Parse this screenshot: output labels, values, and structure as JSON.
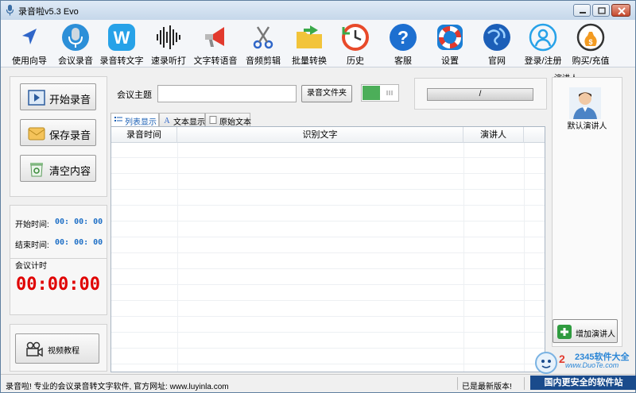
{
  "window": {
    "title": "录音啦v5.3 Evo"
  },
  "toolbar": {
    "items": [
      {
        "label": "使用向导",
        "icon": "navigation-arrow-icon"
      },
      {
        "label": "会议录音",
        "icon": "microphone-icon"
      },
      {
        "label": "录音转文字",
        "icon": "w-letter-icon"
      },
      {
        "label": "速录听打",
        "icon": "waveform-icon"
      },
      {
        "label": "文字转语音",
        "icon": "megaphone-icon"
      },
      {
        "label": "音频剪辑",
        "icon": "scissors-icon"
      },
      {
        "label": "批量转换",
        "icon": "folder-arrow-icon"
      },
      {
        "label": "历史",
        "icon": "history-clock-icon"
      },
      {
        "label": "客服",
        "icon": "question-icon"
      },
      {
        "label": "设置",
        "icon": "lifebuoy-icon"
      },
      {
        "label": "官网",
        "icon": "globe-icon"
      },
      {
        "label": "登录/注册",
        "icon": "user-icon"
      },
      {
        "label": "购买/充值",
        "icon": "money-bag-icon"
      }
    ]
  },
  "left": {
    "start_label": "开始录音",
    "save_label": "保存录音",
    "clear_label": "清空内容",
    "start_time_label": "开始时间:",
    "start_time_value": "00: 00: 00",
    "end_time_label": "结束时间:",
    "end_time_value": "00: 00: 00",
    "timer_caption": "会议计时",
    "timer_value": "00:00:00",
    "video_label": "视频教程"
  },
  "main": {
    "topic_label": "会议主题",
    "topic_value": "",
    "folder_button": "录音文件夹",
    "progress_text": "/",
    "tabs": [
      {
        "label": "列表显示",
        "active": true
      },
      {
        "label": "文本显示",
        "active": false
      },
      {
        "label": "原始文本",
        "active": false
      }
    ],
    "columns": [
      "录音时间",
      "识别文字",
      "演讲人"
    ],
    "rows": []
  },
  "right": {
    "caption": "演讲人",
    "default_speaker": "默认演讲人",
    "add_button": "增加演讲人"
  },
  "status": {
    "message": "录音啦! 专业的会议录音转文字软件, 官方网址: www.luyinla.com",
    "update_message": "已是最新版本!"
  },
  "watermark": {
    "site": "2345软件大全",
    "url": "www.DuoTe.com",
    "slogan": "国内更安全的软件站"
  },
  "colors": {
    "accent": "#1e6fc6",
    "timer": "#e00000",
    "toggle_on": "#4cae59",
    "watermark": "#1a4b8c"
  }
}
